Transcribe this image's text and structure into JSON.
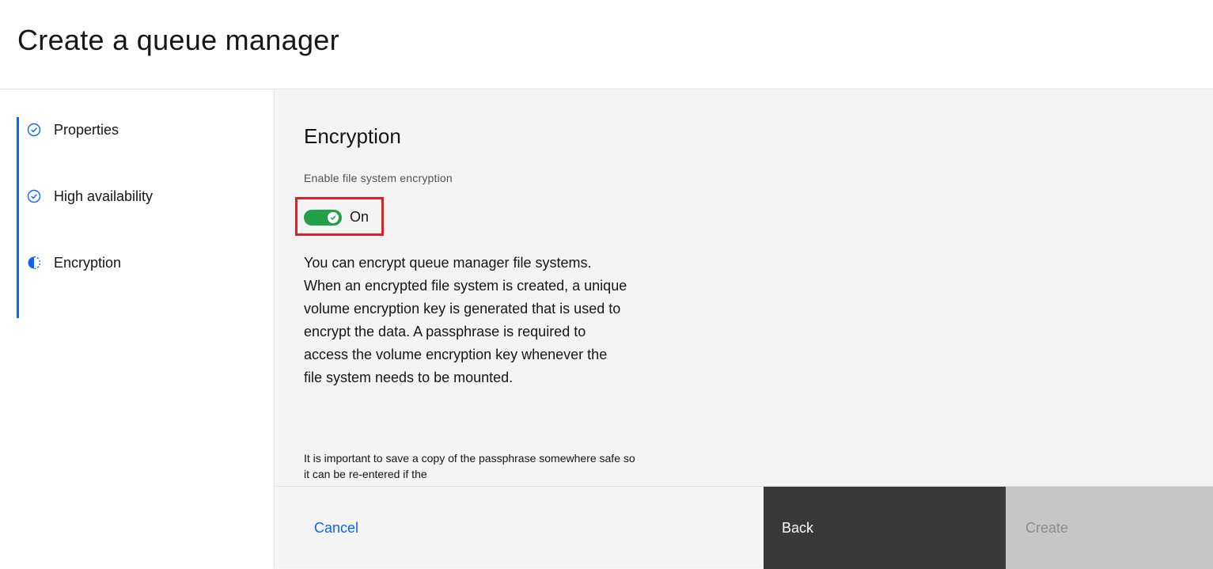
{
  "header": {
    "title": "Create a queue manager"
  },
  "sidebar": {
    "steps": [
      {
        "label": "Properties",
        "state": "complete",
        "icon": "checkmark-outline-icon"
      },
      {
        "label": "High availability",
        "state": "complete",
        "icon": "checkmark-outline-icon"
      },
      {
        "label": "Encryption",
        "state": "current",
        "icon": "incomplete-icon"
      }
    ]
  },
  "main": {
    "section_title": "Encryption",
    "toggle": {
      "label": "Enable file system encryption",
      "state_text": "On",
      "checked": true
    },
    "description": "You can encrypt queue manager file systems. When an encrypted file system is created, a unique volume encryption key is generated that is used to encrypt the data. A passphrase is required to access the volume encryption key whenever the file system needs to be mounted.",
    "note": "It is important to save a copy of the passphrase somewhere safe so it can be re-entered if the"
  },
  "footer": {
    "cancel_label": "Cancel",
    "back_label": "Back",
    "create_label": "Create"
  },
  "colors": {
    "accent": "#0f62fe",
    "toggle_on": "#24a148",
    "highlight": "#e0202a"
  }
}
